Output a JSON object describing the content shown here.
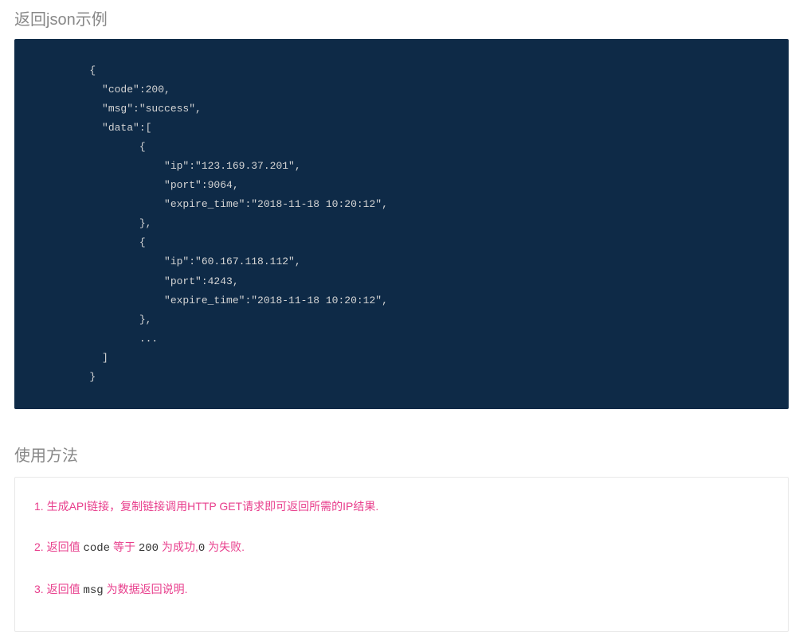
{
  "section1": {
    "title": "返回json示例",
    "code": "        {\n          \"code\":200,\n          \"msg\":\"success\",\n          \"data\":[\n                {\n                    \"ip\":\"123.169.37.201\",\n                    \"port\":9064,\n                    \"expire_time\":\"2018-11-18 10:20:12\",\n                },\n                {\n                    \"ip\":\"60.167.118.112\",\n                    \"port\":4243,\n                    \"expire_time\":\"2018-11-18 10:20:12\",\n                },\n                ...\n          ]\n        }"
  },
  "section2": {
    "title": "使用方法",
    "items": [
      {
        "num": "1. ",
        "pre": "",
        "hl1": "生成API链接，复制链接调用HTTP GET请求即可返回所需的IP结果.",
        "mid": "",
        "hl2": "",
        "post": ""
      },
      {
        "num": "2. ",
        "pre": "返回值 ",
        "code1": "code",
        "mid1": " 等于 ",
        "code2": "200",
        "mid2": " 为成功,",
        "code3": "0",
        "post": " 为失败."
      },
      {
        "num": "3. ",
        "pre": "返回值 ",
        "code1": "msg",
        "post": " 为数据返回说明."
      }
    ]
  }
}
